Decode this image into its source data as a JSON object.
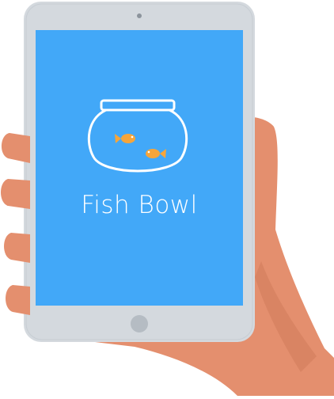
{
  "app": {
    "title": "Fish Bowl"
  },
  "icons": {
    "logo": "fish-bowl-icon",
    "camera": "camera-dot-icon",
    "home_button": "home-button-icon"
  },
  "colors": {
    "screen": "#42a8f8",
    "device_frame": "#d4d9de",
    "skin": "#e48f6e",
    "skin_shadow": "#cf7b5b",
    "fish": "#f6a53a",
    "home_button": "#b5bcc3"
  }
}
